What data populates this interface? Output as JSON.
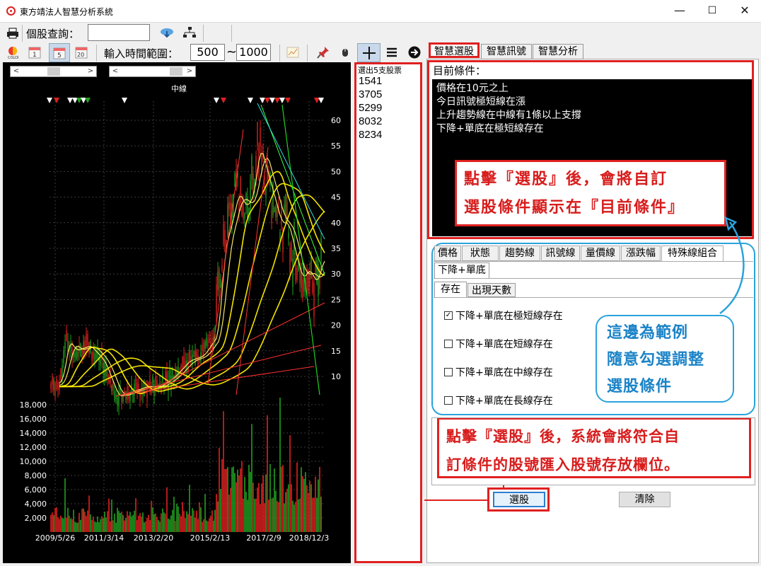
{
  "window": {
    "title": "東方靖法人智慧分析系統",
    "minimize": "—",
    "maximize": "☐",
    "close": "✕"
  },
  "toolbar1": {
    "stock_query_label": "個股查詢：",
    "stock_query_value": ""
  },
  "toolbar2": {
    "date_range_label": "輸入時間範圍：",
    "range_start": "500",
    "range_sep": "~",
    "range_end": "1000",
    "icons": [
      "color-wheel-icon",
      "day-icon",
      "week-icon",
      "month-icon",
      "line-chart-icon",
      "pin-icon",
      "mouse-icon",
      "crosshair-icon",
      "menu-icon",
      "arrow-right-icon"
    ]
  },
  "chart": {
    "label": "中線",
    "price_ticks": [
      "60",
      "55",
      "50",
      "45",
      "40",
      "35",
      "30",
      "25",
      "20",
      "15",
      "10"
    ],
    "volume_ticks": [
      "18,000",
      "16,000",
      "14,000",
      "12,000",
      "10,000",
      "8,000",
      "6,000",
      "4,000",
      "2,000"
    ],
    "date_ticks": [
      "2009/5/26",
      "2011/3/14",
      "2013/2/20",
      "2015/2/13",
      "2017/2/9",
      "2018/12/3"
    ],
    "colors": {
      "background": "#000000",
      "up": "#e02020",
      "down": "#20a020",
      "ma": "#ffee00",
      "trend": "#ff3030"
    }
  },
  "results": {
    "title": "選出5支股票",
    "codes": [
      "1541",
      "3705",
      "5299",
      "8032",
      "8234"
    ]
  },
  "right": {
    "tabs": [
      "智慧選股",
      "智慧訊號",
      "智慧分析"
    ],
    "cond_title": "目前條件：",
    "conditions": [
      "價格在10元之上",
      "今日訊號極短線在漲",
      "上升趨勢線在中線有1條以上支撐",
      "下降+單底在極短線存在"
    ],
    "callout_top": [
      "點擊『選股』後，會將自訂",
      "選股條件顯示在『目前條件』"
    ],
    "criteria_tabs": [
      "價格",
      "狀態",
      "趨勢線",
      "訊號線",
      "量價線",
      "漲跌幅",
      "特殊線組合"
    ],
    "sub_tab": "下降+單底",
    "sub_sub_tabs": [
      "存在",
      "出現天數"
    ],
    "checkboxes": [
      {
        "label": "下降+單底在極短線存在",
        "checked": true
      },
      {
        "label": "下降+單底在短線存在",
        "checked": false
      },
      {
        "label": "下降+單底在中線存在",
        "checked": false
      },
      {
        "label": "下降+單底在長線存在",
        "checked": false
      }
    ],
    "callout_blue": [
      "這邊為範例",
      "隨意勾選調整",
      "選股條件"
    ],
    "callout_bottom": [
      "點擊『選股』後，系統會將符合自",
      "訂條件的股號匯入股號存放欄位。"
    ],
    "select_button": "選股",
    "clear_button": "清除"
  },
  "colors": {
    "highlight_red": "#e02020",
    "highlight_blue": "#2aa3dc"
  }
}
